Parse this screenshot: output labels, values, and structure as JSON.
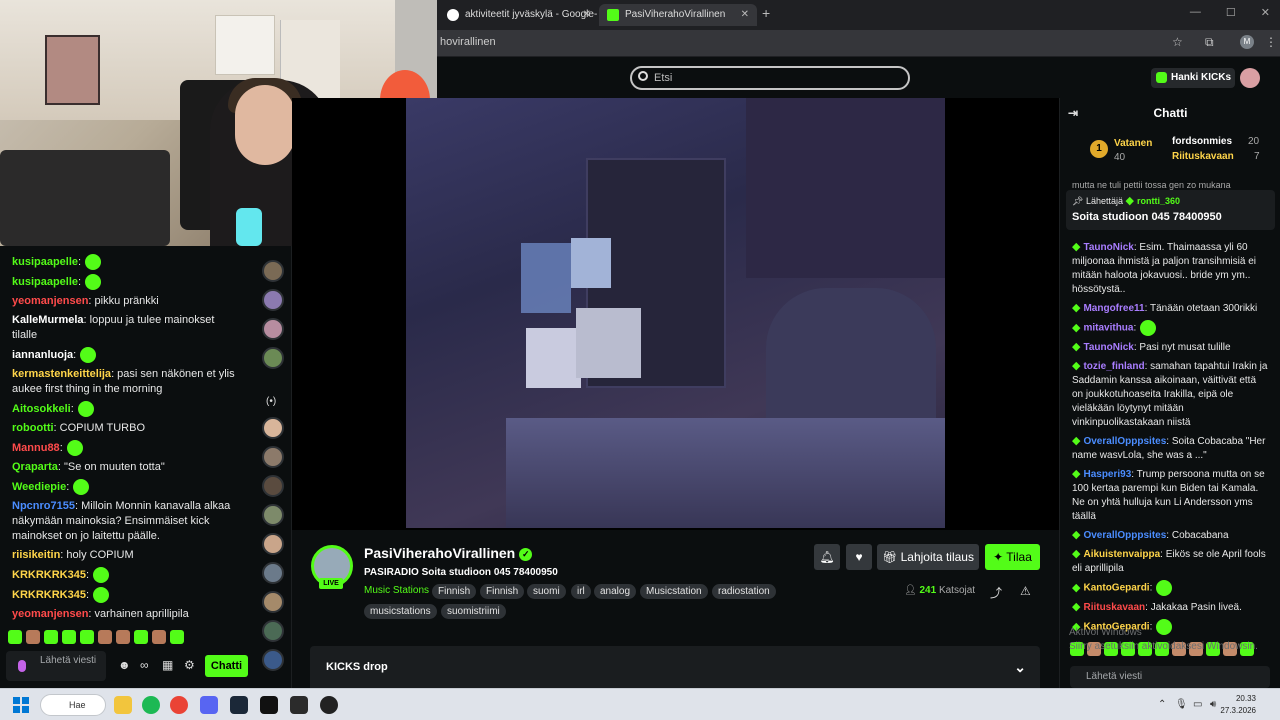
{
  "browser": {
    "tabs": [
      {
        "title": "aktiviteetit jyväskylä - Google-h"
      },
      {
        "title": "PasiViherahoVirallinen Stream"
      }
    ],
    "url": "hovirallinen",
    "profile_initial": "M"
  },
  "header": {
    "search_placeholder": "Etsi",
    "kicks_button": "Hanki KICKs"
  },
  "left_chat": {
    "messages": [
      {
        "user": "kusipaapelle",
        "color": "#53fc18",
        "text": ""
      },
      {
        "user": "kusipaapelle",
        "color": "#53fc18",
        "text": ""
      },
      {
        "user": "yeomanjensen",
        "color": "#ff4b4b",
        "text": " pikku pränkki"
      },
      {
        "user": "KalleMurmela",
        "color": "#ffffff",
        "text": " loppuu ja tulee mainokset tilalle"
      },
      {
        "user": "iannanluoja",
        "color": "#ffffff",
        "text": ""
      },
      {
        "user": "kermastenkeittelija",
        "color": "#ffd54a",
        "text": " pasi sen näkönen et ylis aukee first thing in the morning"
      },
      {
        "user": "Aitosokkeli",
        "color": "#53fc18",
        "text": ""
      },
      {
        "user": "robootti",
        "color": "#53fc18",
        "text": " COPIUM TURBO"
      },
      {
        "user": "Mannu88",
        "color": "#ff4b4b",
        "text": ""
      },
      {
        "user": "Qraparta",
        "color": "#53fc18",
        "text": " \"Se on muuten totta\""
      },
      {
        "user": "Weediepie",
        "color": "#53fc18",
        "text": ""
      },
      {
        "user": "Npcnro7155",
        "color": "#4b8dff",
        "text": " Milloin Monnin kanavalla alkaa näkymään mainoksia? Ensimmäiset kick mainokset on jo laitettu päälle."
      },
      {
        "user": "riisikeitin",
        "color": "#ffd54a",
        "text": " holy COPIUM"
      },
      {
        "user": "KRKRKRK345",
        "color": "#ffd54a",
        "text": ""
      },
      {
        "user": "KRKRKRK345",
        "color": "#ffd54a",
        "text": ""
      },
      {
        "user": "yeomanjensen",
        "color": "#ff4b4b",
        "text": " varhainen aprillipila"
      }
    ],
    "input_placeholder": "Lähetä viesti",
    "chat_button": "Chatti"
  },
  "channel": {
    "name": "PasiViherahoVirallinen",
    "live_label": "LIVE",
    "stream_title": "PASIRADIO Soita studioon 045 78400950",
    "category": "Music Stations",
    "tags": [
      "Finnish",
      "Finnish",
      "suomi",
      "irl",
      "analog",
      "Musicstation",
      "radiostation",
      "musicstations",
      "suomistriimi"
    ],
    "gift_button": "Lahjoita tilaus",
    "subscribe_button": "Tilaa",
    "viewers_count": "241",
    "viewers_label": "Katsojat",
    "kicks_drop": "KICKS drop"
  },
  "right_chat": {
    "title": "Chatti",
    "leaderboard": [
      {
        "name": "Vatanen",
        "value": "40"
      },
      {
        "name": "fordsonmies",
        "value": "20"
      },
      {
        "name": "Riituskavaan",
        "value": "7"
      }
    ],
    "pinned_by_label": "Lähettäjä",
    "pinned_user": "rontti_360",
    "pinned_text": "Soita studioon 045 78400950",
    "partial_top": "mutta ne tuli pettii tossa gen zo mukana",
    "messages": [
      {
        "user": "TaunoNick",
        "color": "#a97dff",
        "text": " Esim. Thaimaassa yli 60 miljoonaa ihmistä ja paljon transihmisiä ei mitään haloota jokavuosi.. bride ym ym.. hössötystä.."
      },
      {
        "user": "Mangofree11",
        "color": "#a97dff",
        "text": " Tänään otetaan 300rikki"
      },
      {
        "user": "mitavithua",
        "color": "#a97dff",
        "text": ""
      },
      {
        "user": "TaunoNick",
        "color": "#a97dff",
        "text": " Pasi nyt musat tulille"
      },
      {
        "user": "tozie_finland",
        "color": "#a97dff",
        "text": " samahan tapahtui Irakin ja Saddamin kanssa aikoinaan, väittivät että on joukkotuhoaseita Irakilla, eipä ole vieläkään löytynyt mitään vinkinpuolikastakaan niistä"
      },
      {
        "user": "OverallOpppsites",
        "color": "#4b8dff",
        "text": " Soita Cobacaba \"Her name wasvLola, she was a ...\""
      },
      {
        "user": "Hasperi93",
        "color": "#4b8dff",
        "text": " Trump persoona mutta on se 100 kertaa parempi kun Biden tai Kamala. Ne on yhtä hulluja kun Li Andersson yms täällä"
      },
      {
        "user": "OverallOpppsites",
        "color": "#4b8dff",
        "text": " Cobacabana"
      },
      {
        "user": "Aikuistenvaippa",
        "color": "#ffd54a",
        "text": " Eikös se ole April fools eli aprillipila"
      },
      {
        "user": "KantoGepardi",
        "color": "#ffd54a",
        "text": ""
      },
      {
        "user": "Riituskavaan",
        "color": "#ff4b4b",
        "text": " Jakakaa Pasin liveä."
      },
      {
        "user": "KantoGepardi",
        "color": "#ffd54a",
        "text": ""
      }
    ],
    "input_placeholder": "Lähetä viesti"
  },
  "watermark": {
    "line1": "Aktivoi Windows",
    "line2": "Siirry asetuksiin aktivoidaksesi Windowsin."
  },
  "taskbar": {
    "search_label": "Hae",
    "time": "20.33",
    "date": "27.3.2026"
  },
  "colors": {
    "accent": "#53fc18",
    "background": "#0b0e0f"
  }
}
